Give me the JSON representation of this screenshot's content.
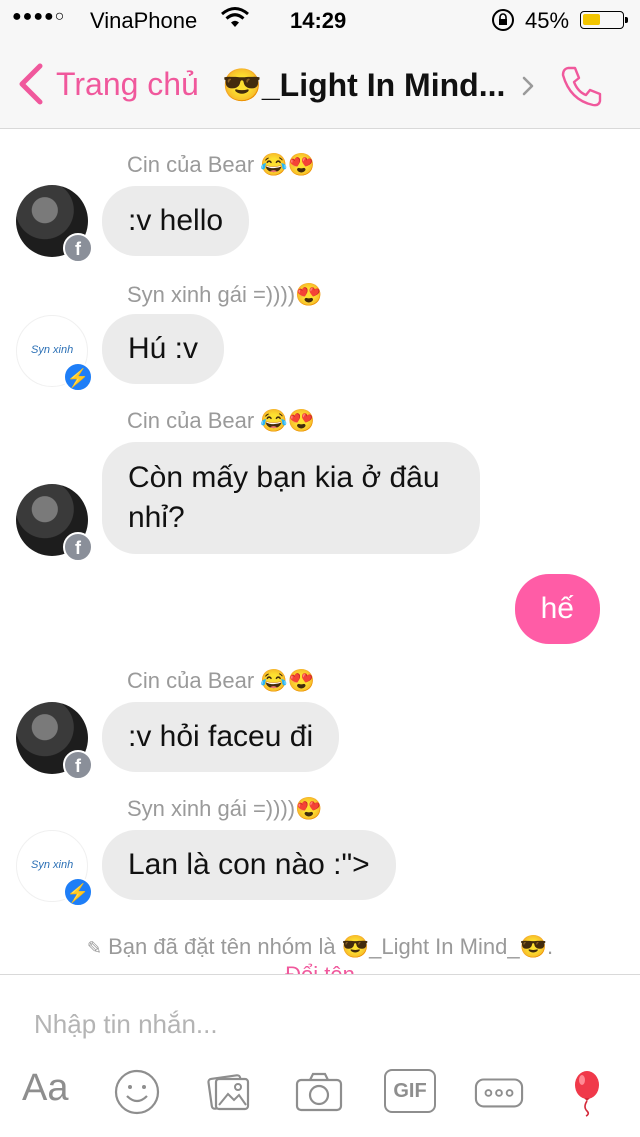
{
  "status_bar": {
    "signal": "●●●●○",
    "carrier": "VinaPhone",
    "time": "14:29",
    "battery": "45%",
    "battery_level": 0.45
  },
  "nav": {
    "back_label": "Trang chủ",
    "title_emoji": "😎",
    "title": "_Light In Mind..."
  },
  "messages": [
    {
      "sender": "Cin của Bear 😂😍",
      "text": ":v hello"
    },
    {
      "sender": "Syn xinh gái =))))😍",
      "text": "Hú :v"
    },
    {
      "sender": "Cin của Bear 😂😍",
      "text": "Còn mấy bạn kia ở đâu nhỉ?"
    },
    {
      "text": "hế"
    },
    {
      "sender": "Cin của Bear 😂😍",
      "text": ":v hỏi faceu đi"
    },
    {
      "sender": "Syn xinh gái =))))😍",
      "text": "Lan là con nào :\">"
    }
  ],
  "system_notice": {
    "text": "Bạn đã đặt tên nhóm là 😎_Light In Mind_😎.",
    "action": "Đổi tên"
  },
  "composer": {
    "placeholder": "Nhập tin nhắn...",
    "aa_label": "Aa",
    "gif_label": "GIF"
  },
  "colors": {
    "accent": "#f0589c",
    "my_bubble": "#ff5ca6",
    "their_bubble": "#ebebeb",
    "messenger_badge": "#1e7ef7"
  }
}
